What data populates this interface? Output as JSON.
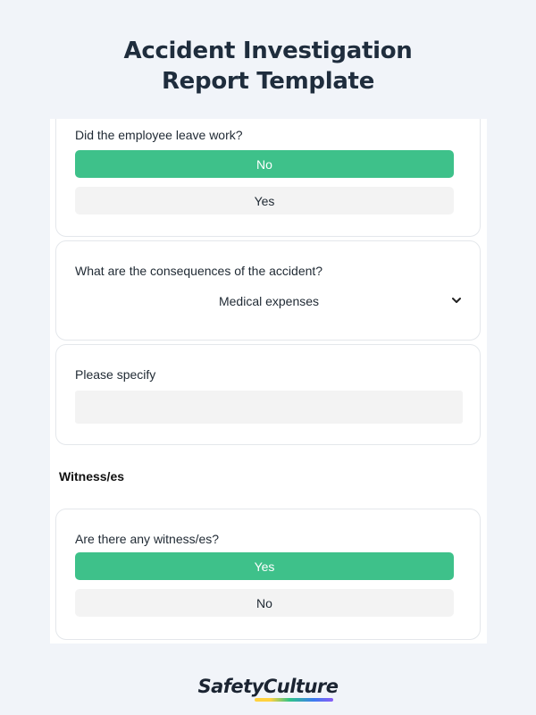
{
  "header": {
    "title_line1": "Accident Investigation",
    "title_line2": "Report Template"
  },
  "form": {
    "leave_work": {
      "question": "Did the employee leave work?",
      "options": [
        {
          "label": "No",
          "selected": true
        },
        {
          "label": "Yes",
          "selected": false
        }
      ]
    },
    "consequences": {
      "question": "What are the consequences of the accident?",
      "selected_value": "Medical expenses"
    },
    "specify": {
      "question": "Please specify",
      "value": ""
    },
    "witness_section": {
      "heading": "Witness/es",
      "question": "Are there any witness/es?",
      "options": [
        {
          "label": "Yes",
          "selected": true
        },
        {
          "label": "No",
          "selected": false
        }
      ]
    }
  },
  "branding": {
    "logo_text": "SafetyCulture"
  },
  "colors": {
    "selected_option": "#3ec18a",
    "unselected_option": "#f3f3f3",
    "page_background": "#f1f4f9",
    "title_text": "#1f2d3d"
  },
  "icons": {
    "dropdown": "chevron-down-icon"
  }
}
